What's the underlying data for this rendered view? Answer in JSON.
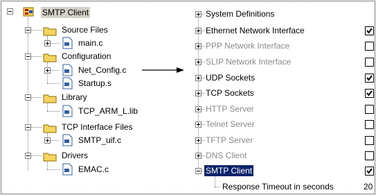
{
  "left_tree": {
    "root": "SMTP Client",
    "source_files": {
      "label": "Source Files",
      "children": [
        "main.c"
      ]
    },
    "configuration": {
      "label": "Configuration",
      "children": [
        "Net_Config.c",
        "Startup.s"
      ]
    },
    "library": {
      "label": "Library",
      "children": [
        "TCP_ARM_L.lib"
      ]
    },
    "tcp_interface": {
      "label": "TCP Interface Files",
      "children": [
        "SMTP_uif.c"
      ]
    },
    "drivers": {
      "label": "Drivers",
      "children": [
        "EMAC.c"
      ]
    }
  },
  "config_options": [
    {
      "label": "System Definitions",
      "enabled": true,
      "checked": null
    },
    {
      "label": "Ethernet Network Interface",
      "enabled": true,
      "checked": true
    },
    {
      "label": "PPP Network Interface",
      "enabled": false,
      "checked": false
    },
    {
      "label": "SLIP Network Interface",
      "enabled": false,
      "checked": false
    },
    {
      "label": "UDP Sockets",
      "enabled": true,
      "checked": true
    },
    {
      "label": "TCP Sockets",
      "enabled": true,
      "checked": true
    },
    {
      "label": "HTTP Server",
      "enabled": false,
      "checked": false
    },
    {
      "label": "Telnet Server",
      "enabled": false,
      "checked": false
    },
    {
      "label": "TFTP Server",
      "enabled": false,
      "checked": false
    },
    {
      "label": "DNS Client",
      "enabled": false,
      "checked": false
    },
    {
      "label": "SMTP Client",
      "enabled": true,
      "checked": true,
      "selected": true
    }
  ],
  "smtp_child": {
    "label": "Response Timeout in seconds",
    "value": "20"
  },
  "colors": {
    "selection": "#0a246a",
    "disabled_text": "#8a8a8a",
    "folder": "#f4d35e"
  },
  "icons": {
    "folder": "folder-icon",
    "file": "file-icon",
    "project": "project-icon",
    "arrow": "arrow-right-icon"
  }
}
